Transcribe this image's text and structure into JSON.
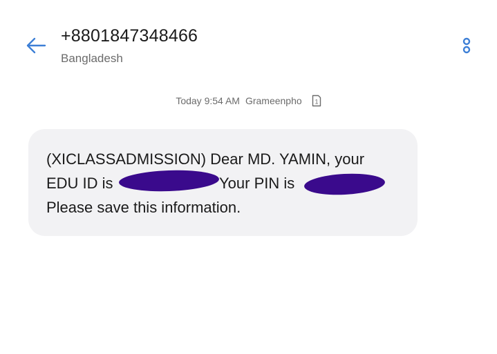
{
  "header": {
    "title": "+8801847348466",
    "subtitle": "Bangladesh",
    "back_icon": "arrow-left-icon",
    "more_icon": "more-vertical-icon"
  },
  "message": {
    "time": "Today 9:54 AM",
    "carrier": "Grameenpho",
    "sim_icon": "sim-1-icon",
    "sim_number": "1",
    "lines": [
      "(XICLASSADMISSION) Dear MD. YAMIN, your",
      "EDU ID is",
      "Your PIN is",
      "Please save this information."
    ]
  },
  "colors": {
    "accent": "#3d7fd6",
    "bubble": "#f2f2f4",
    "link": "#2f6fd6",
    "redaction": "#3a0a8c"
  }
}
